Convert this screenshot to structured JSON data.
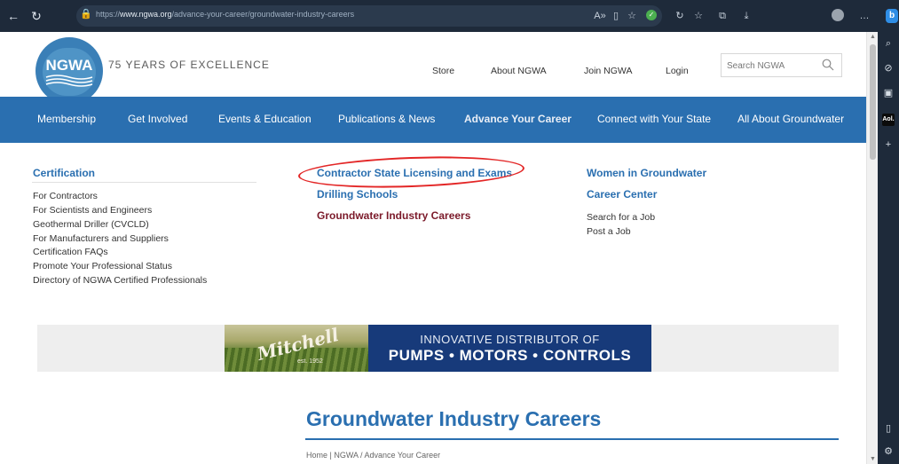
{
  "browser": {
    "url_prefix": "https://",
    "url_host": "www.ngwa.org",
    "url_path": "/advance-your-career/groundwater-industry-careers"
  },
  "header": {
    "logo_text": "NGWA",
    "tagline": "75 YEARS OF EXCELLENCE",
    "links": [
      "Store",
      "About NGWA",
      "Join NGWA",
      "Login"
    ],
    "search_placeholder": "Search NGWA"
  },
  "main_nav": [
    "Membership",
    "Get Involved",
    "Events & Education",
    "Publications & News",
    "Advance Your Career",
    "Connect with Your State",
    "All About Groundwater"
  ],
  "mega_menu": {
    "col1": {
      "title": "Certification",
      "items": [
        "For Contractors",
        "For Scientists and Engineers",
        "Geothermal Driller (CVCLD)",
        "For Manufacturers and Suppliers",
        "Certification FAQs",
        "Promote Your Professional Status",
        "Directory of NGWA Certified Professionals"
      ]
    },
    "col2": {
      "links": [
        "Contractor State Licensing and Exams",
        "Drilling Schools",
        "Groundwater Industry Careers"
      ]
    },
    "col3": {
      "links": [
        "Women in Groundwater",
        "Career Center"
      ],
      "items": [
        "Search for a Job",
        "Post a Job"
      ]
    }
  },
  "ad": {
    "logo": "Mitchell",
    "est": "est. 1952",
    "line1": "INNOVATIVE DISTRIBUTOR OF",
    "line2": "PUMPS • MOTORS • CONTROLS"
  },
  "page": {
    "title": "Groundwater Industry Careers",
    "breadcrumb": "Home | NGWA / Advance Your Career"
  },
  "colors": {
    "nav_blue": "#2a6fb0",
    "dark_red": "#7b1a2a",
    "annotation_red": "#e32626",
    "ad_navy": "#173a7a"
  }
}
